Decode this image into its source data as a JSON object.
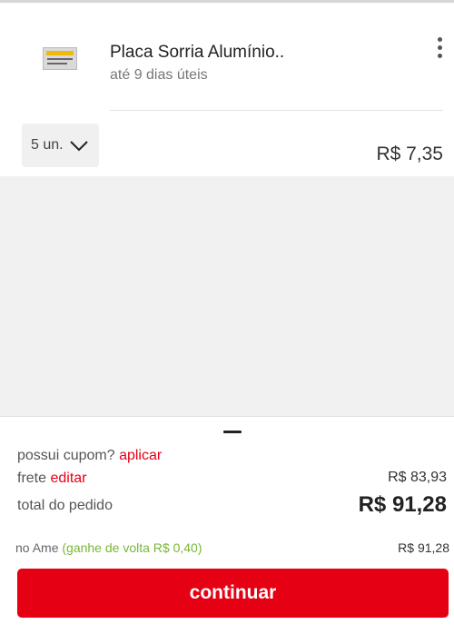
{
  "item": {
    "title": "Placa Sorria Alumínio..",
    "delivery": "até 9 dias úteis",
    "quantity": "5 un.",
    "price": "R$ 7,35"
  },
  "summary": {
    "coupon_label": "possui cupom?",
    "coupon_action": "aplicar",
    "frete_label": "frete",
    "frete_action": "editar",
    "frete_value": "R$ 83,93",
    "total_label": "total do pedido",
    "total_value": "R$ 91,28",
    "ame_label": "no Ame",
    "ame_cashback": "(ganhe de volta R$ 0,40)",
    "ame_value": "R$ 91,28"
  },
  "actions": {
    "continue_label": "continuar"
  },
  "colors": {
    "accent": "#e60014",
    "cashback": "#79b536",
    "background": "#f1f1f1"
  },
  "icons": [
    "more-vertical-icon",
    "chevron-down-icon",
    "drag-handle-icon"
  ]
}
